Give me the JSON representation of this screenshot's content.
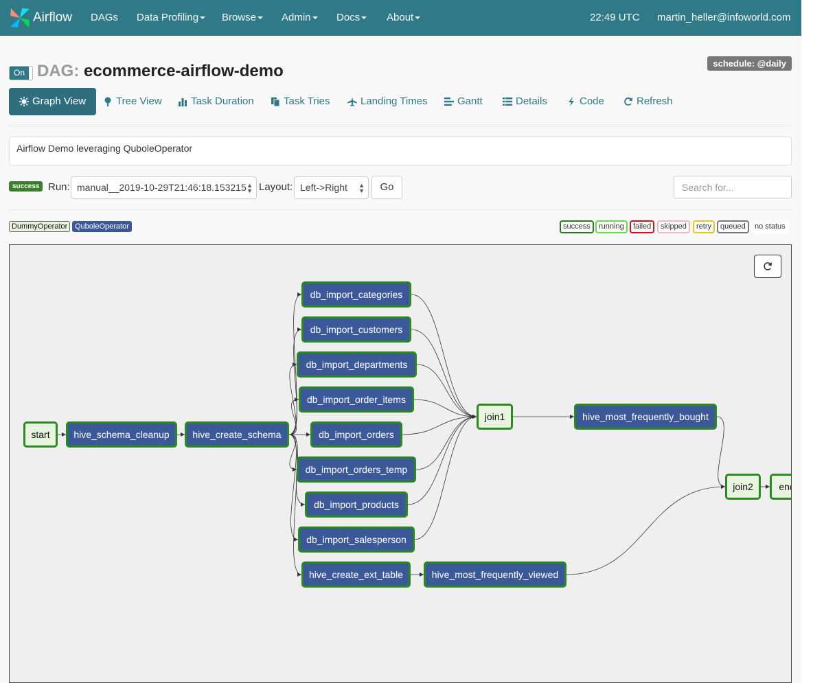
{
  "navbar": {
    "brand": "Airflow",
    "items": [
      {
        "label": "DAGs",
        "dropdown": false
      },
      {
        "label": "Data Profiling",
        "dropdown": true
      },
      {
        "label": "Browse",
        "dropdown": true
      },
      {
        "label": "Admin",
        "dropdown": true
      },
      {
        "label": "Docs",
        "dropdown": true
      },
      {
        "label": "About",
        "dropdown": true
      }
    ],
    "time": "22:49 UTC",
    "user": "martin_heller@infoworld.com"
  },
  "dag": {
    "toggle": "On",
    "prefix": "DAG:",
    "name": "ecommerce-airflow-demo",
    "schedule": "schedule: @daily",
    "description": "Airflow Demo leveraging QuboleOperator"
  },
  "tabs": [
    {
      "label": "Graph View",
      "icon": "sun-icon",
      "active": true
    },
    {
      "label": "Tree View",
      "icon": "tree-icon"
    },
    {
      "label": "Task Duration",
      "icon": "bar-chart-icon"
    },
    {
      "label": "Task Tries",
      "icon": "files-icon"
    },
    {
      "label": "Landing Times",
      "icon": "plane-icon"
    },
    {
      "label": "Gantt",
      "icon": "gantt-icon"
    },
    {
      "label": "Details",
      "icon": "list-icon"
    },
    {
      "label": "Code",
      "icon": "flash-icon"
    },
    {
      "label": "Refresh",
      "icon": "refresh-icon"
    }
  ],
  "controls": {
    "run_status": "success",
    "run_label": "Run:",
    "run_value": "manual__2019-10-29T21:46:18.153215",
    "layout_label": "Layout:",
    "layout_value": "Left->Right",
    "go": "Go",
    "search_placeholder": "Search for..."
  },
  "legend": {
    "operators": [
      {
        "label": "DummyOperator",
        "bg": "#e8f4e0",
        "color": "#111111"
      },
      {
        "label": "QuboleOperator",
        "bg": "#3b5998",
        "color": "#ffffff"
      }
    ],
    "states": [
      {
        "label": "success",
        "color": "#2a7a1e"
      },
      {
        "label": "running",
        "color": "#66dd44"
      },
      {
        "label": "failed",
        "color": "#cc1122"
      },
      {
        "label": "skipped",
        "color": "#f0b8c0"
      },
      {
        "label": "retry",
        "color": "#e8c820"
      },
      {
        "label": "queued",
        "color": "#777777"
      },
      {
        "label": "no status",
        "color": "#ffffff"
      }
    ]
  },
  "graph": {
    "nodes": [
      {
        "id": "start",
        "label": "start",
        "type": "dummy"
      },
      {
        "id": "hive_schema_cleanup",
        "label": "hive_schema_cleanup",
        "type": "qubole"
      },
      {
        "id": "hive_create_schema",
        "label": "hive_create_schema",
        "type": "qubole"
      },
      {
        "id": "db_import_categories",
        "label": "db_import_categories",
        "type": "qubole"
      },
      {
        "id": "db_import_customers",
        "label": "db_import_customers",
        "type": "qubole"
      },
      {
        "id": "db_import_departments",
        "label": "db_import_departments",
        "type": "qubole"
      },
      {
        "id": "db_import_order_items",
        "label": "db_import_order_items",
        "type": "qubole"
      },
      {
        "id": "db_import_orders",
        "label": "db_import_orders",
        "type": "qubole"
      },
      {
        "id": "db_import_orders_temp",
        "label": "db_import_orders_temp",
        "type": "qubole"
      },
      {
        "id": "db_import_products",
        "label": "db_import_products",
        "type": "qubole"
      },
      {
        "id": "db_import_salesperson",
        "label": "db_import_salesperson",
        "type": "qubole"
      },
      {
        "id": "hive_create_ext_table",
        "label": "hive_create_ext_table",
        "type": "qubole"
      },
      {
        "id": "hive_most_frequently_viewed",
        "label": "hive_most_frequently_viewed",
        "type": "qubole"
      },
      {
        "id": "join1",
        "label": "join1",
        "type": "dummy"
      },
      {
        "id": "hive_most_frequently_bought",
        "label": "hive_most_frequently_bought",
        "type": "qubole"
      },
      {
        "id": "join2",
        "label": "join2",
        "type": "dummy"
      },
      {
        "id": "end",
        "label": "end",
        "type": "dummy"
      }
    ],
    "edges": [
      [
        "start",
        "hive_schema_cleanup"
      ],
      [
        "hive_schema_cleanup",
        "hive_create_schema"
      ],
      [
        "hive_create_schema",
        "db_import_categories"
      ],
      [
        "hive_create_schema",
        "db_import_customers"
      ],
      [
        "hive_create_schema",
        "db_import_departments"
      ],
      [
        "hive_create_schema",
        "db_import_order_items"
      ],
      [
        "hive_create_schema",
        "db_import_orders"
      ],
      [
        "hive_create_schema",
        "db_import_orders_temp"
      ],
      [
        "hive_create_schema",
        "db_import_products"
      ],
      [
        "hive_create_schema",
        "db_import_salesperson"
      ],
      [
        "hive_create_schema",
        "hive_create_ext_table"
      ],
      [
        "db_import_categories",
        "join1"
      ],
      [
        "db_import_customers",
        "join1"
      ],
      [
        "db_import_departments",
        "join1"
      ],
      [
        "db_import_order_items",
        "join1"
      ],
      [
        "db_import_orders",
        "join1"
      ],
      [
        "db_import_orders_temp",
        "join1"
      ],
      [
        "db_import_products",
        "join1"
      ],
      [
        "db_import_salesperson",
        "join1"
      ],
      [
        "join1",
        "hive_most_frequently_bought"
      ],
      [
        "hive_most_frequently_bought",
        "join2"
      ],
      [
        "hive_create_ext_table",
        "hive_most_frequently_viewed"
      ],
      [
        "hive_most_frequently_viewed",
        "join2"
      ],
      [
        "join2",
        "end"
      ]
    ]
  }
}
